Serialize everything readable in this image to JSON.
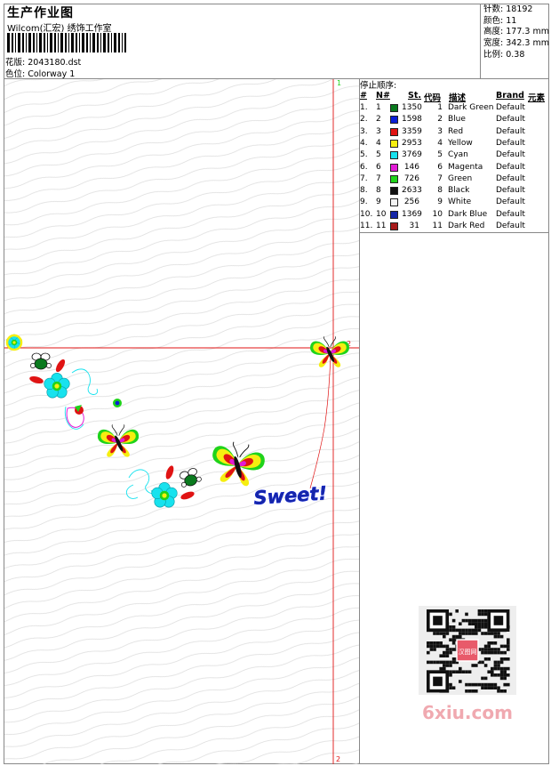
{
  "header": {
    "title": "生产作业图",
    "company": "Wilcom(汇宏) 绣饰工作室",
    "pattern_label": "花版:",
    "pattern_value": "2043180.dst",
    "colorway_label": "色位:",
    "colorway_value": "Colorway 1"
  },
  "stats": [
    {
      "label": "针数:",
      "value": "18192"
    },
    {
      "label": "颜色:",
      "value": "11"
    },
    {
      "label": "高度:",
      "value": "177.3 mm"
    },
    {
      "label": "宽度:",
      "value": "342.3 mm"
    },
    {
      "label": "比例:",
      "value": "0.38"
    }
  ],
  "stop_sequence": {
    "title": "停止顺序:",
    "headers": {
      "num": "#",
      "n": "N#",
      "st": "St.",
      "code": "代码",
      "desc": "描述",
      "brand": "Brand",
      "elem": "元素"
    },
    "rows": [
      {
        "num": "1.",
        "n": "1",
        "st": "1350",
        "code": "1",
        "desc": "Dark Green",
        "brand": "Default",
        "color": "#0a7a1e"
      },
      {
        "num": "2.",
        "n": "2",
        "st": "1598",
        "code": "2",
        "desc": "Blue",
        "brand": "Default",
        "color": "#0a1fd6"
      },
      {
        "num": "3.",
        "n": "3",
        "st": "3359",
        "code": "3",
        "desc": "Red",
        "brand": "Default",
        "color": "#e01313"
      },
      {
        "num": "4.",
        "n": "4",
        "st": "2953",
        "code": "4",
        "desc": "Yellow",
        "brand": "Default",
        "color": "#f6ee10"
      },
      {
        "num": "5.",
        "n": "5",
        "st": "3769",
        "code": "5",
        "desc": "Cyan",
        "brand": "Default",
        "color": "#17e2ee"
      },
      {
        "num": "6.",
        "n": "6",
        "st": "146",
        "code": "6",
        "desc": "Magenta",
        "brand": "Default",
        "color": "#e21bd6"
      },
      {
        "num": "7.",
        "n": "7",
        "st": "726",
        "code": "7",
        "desc": "Green",
        "brand": "Default",
        "color": "#1fd31a"
      },
      {
        "num": "8.",
        "n": "8",
        "st": "2633",
        "code": "8",
        "desc": "Black",
        "brand": "Default",
        "color": "#111111"
      },
      {
        "num": "9.",
        "n": "9",
        "st": "256",
        "code": "9",
        "desc": "White",
        "brand": "Default",
        "color": "#f4f4f4"
      },
      {
        "num": "10.",
        "n": "10",
        "st": "1369",
        "code": "10",
        "desc": "Dark Blue",
        "brand": "Default",
        "color": "#1626a8"
      },
      {
        "num": "11.",
        "n": "11",
        "st": "31",
        "code": "11",
        "desc": "Dark Red",
        "brand": "Default",
        "color": "#a81a1a"
      }
    ]
  },
  "design": {
    "guide_label_1": "1",
    "guide_label_2": "2",
    "guide_label_2b": "2",
    "sweet_text": "Sweet!"
  },
  "watermark": "6xiu.com",
  "qr_badge": "汉图网"
}
